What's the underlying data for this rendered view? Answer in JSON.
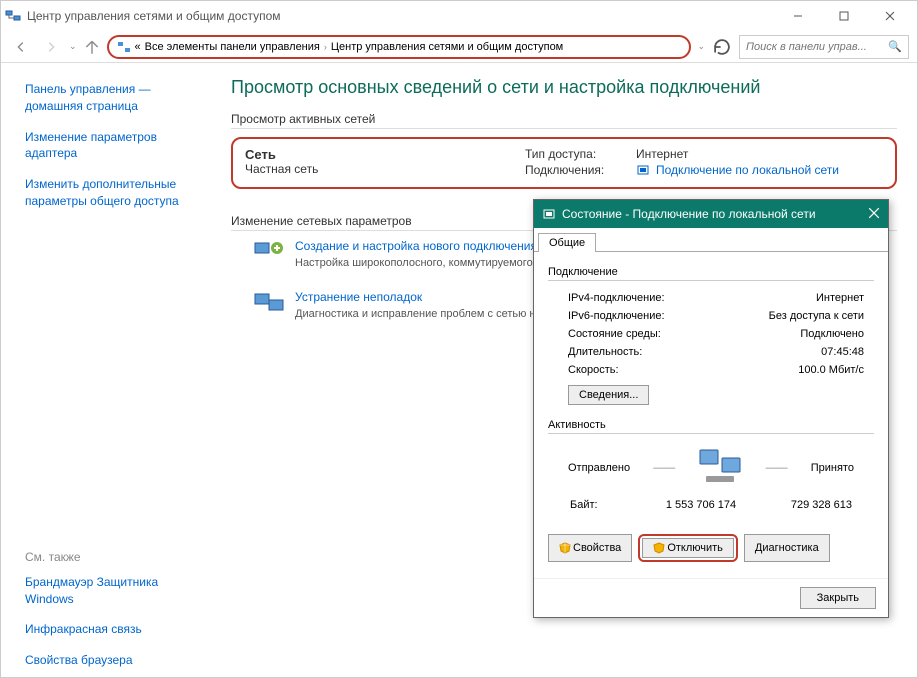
{
  "window": {
    "title": "Центр управления сетями и общим доступом"
  },
  "breadcrumb": {
    "prefix": "«",
    "item1": "Все элементы панели управления",
    "item2": "Центр управления сетями и общим доступом"
  },
  "search": {
    "placeholder": "Поиск в панели управ..."
  },
  "sidebar": {
    "home": "Панель управления — домашняя страница",
    "adapter": "Изменение параметров адаптера",
    "sharing": "Изменить дополнительные параметры общего доступа",
    "see_also": "См. также",
    "firewall": "Брандмауэр Защитника Windows",
    "infrared": "Инфракрасная связь",
    "browser": "Свойства браузера"
  },
  "main": {
    "title": "Просмотр основных сведений о сети и настройка подключений",
    "active_label": "Просмотр активных сетей",
    "net": {
      "name": "Сеть",
      "kind": "Частная сеть",
      "access_label": "Тип доступа:",
      "access_value": "Интернет",
      "conn_label": "Подключения:",
      "conn_value": "Подключение по локальной сети"
    },
    "change_label": "Изменение сетевых параметров",
    "action1": {
      "title": "Создание и настройка нового подключения",
      "desc": "Настройка широкополосного, коммутируемого маршрутизатора или точки доступа."
    },
    "action2": {
      "title": "Устранение неполадок",
      "desc": "Диагностика и исправление проблем с сетью неполадок."
    }
  },
  "dialog": {
    "title": "Состояние - Подключение по локальной сети",
    "tab": "Общие",
    "fs1": "Подключение",
    "ipv4_label": "IPv4-подключение:",
    "ipv4_value": "Интернет",
    "ipv6_label": "IPv6-подключение:",
    "ipv6_value": "Без доступа к сети",
    "media_label": "Состояние среды:",
    "media_value": "Подключено",
    "duration_label": "Длительность:",
    "duration_value": "07:45:48",
    "speed_label": "Скорость:",
    "speed_value": "100.0 Мбит/с",
    "details": "Сведения...",
    "fs2": "Активность",
    "sent": "Отправлено",
    "recv": "Принято",
    "bytes_label": "Байт:",
    "bytes_sent": "1 553 706 174",
    "bytes_recv": "729 328 613",
    "btn_props": "Свойства",
    "btn_disable": "Отключить",
    "btn_diag": "Диагностика",
    "btn_close": "Закрыть"
  }
}
